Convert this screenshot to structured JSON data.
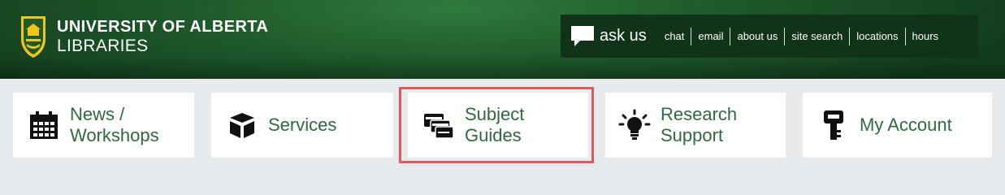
{
  "header": {
    "logo_line1": "UNIVERSITY OF ALBERTA",
    "logo_line2": "LIBRARIES",
    "ask_label": "ask us",
    "ask_links": [
      "chat",
      "email",
      "about us",
      "site search",
      "locations",
      "hours"
    ]
  },
  "nav": {
    "items": [
      {
        "label": "News /\nWorkshops",
        "icon": "calendar-icon"
      },
      {
        "label": "Services",
        "icon": "box-icon"
      },
      {
        "label": "Subject\nGuides",
        "icon": "cards-icon"
      },
      {
        "label": "Research\nSupport",
        "icon": "lightbulb-icon"
      },
      {
        "label": "My Account",
        "icon": "key-icon"
      }
    ]
  },
  "colors": {
    "header_green": "#1f5a2b",
    "accent_green": "#2f6a3c",
    "highlight_red": "#e05a5a",
    "nav_background": "#e8ebee"
  }
}
